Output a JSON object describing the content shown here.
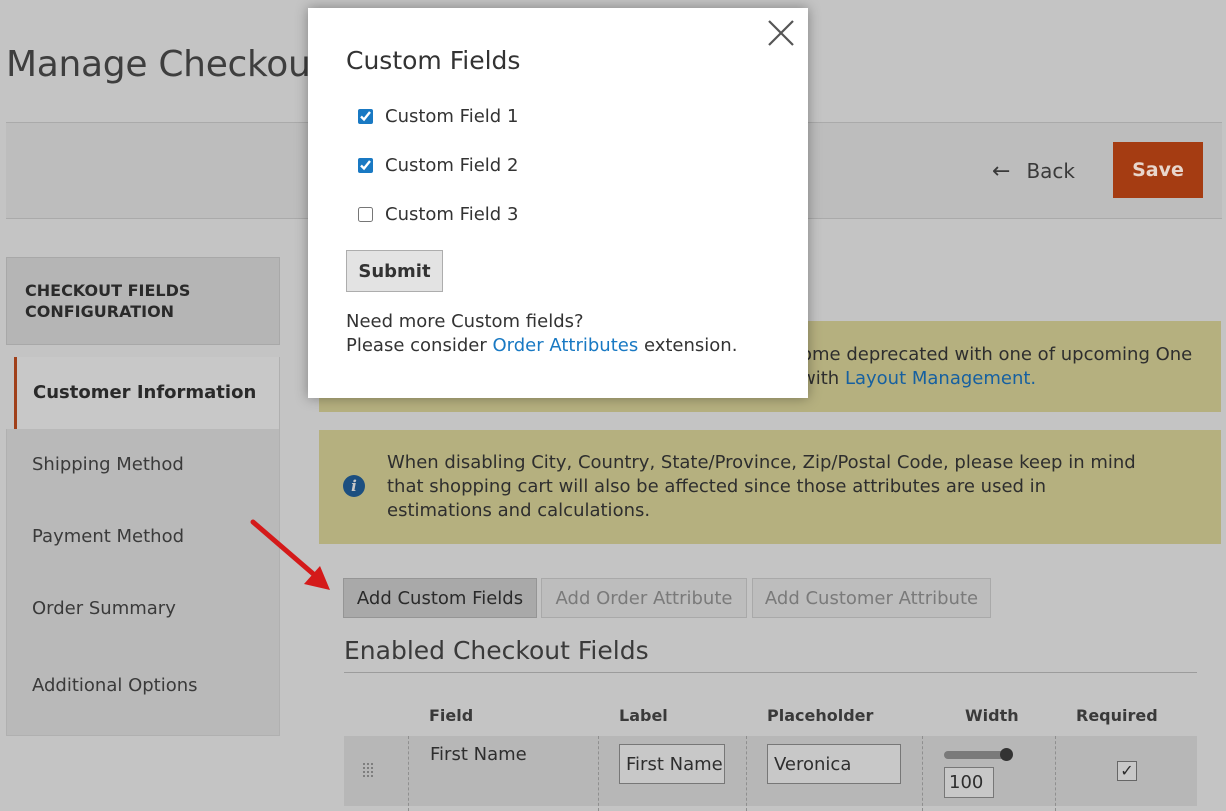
{
  "page": {
    "title": "Manage Checkout"
  },
  "toolbar": {
    "back_label": "Back",
    "back_arrow": "←",
    "save_label": "Save"
  },
  "sidebar": {
    "title": "CHECKOUT FIELDS CONFIGURATION",
    "items": [
      {
        "label": "Customer Information",
        "active": true
      },
      {
        "label": "Shipping Method"
      },
      {
        "label": "Payment Method"
      },
      {
        "label": "Order Summary"
      },
      {
        "label": "Additional Options"
      }
    ]
  },
  "notices": {
    "deprecated_text": "ome deprecated with one of upcoming One",
    "deprecated_text2": "with",
    "deprecated_link": "Layout Management.",
    "info_icon": "i",
    "info_text": "When disabling City, Country, State/Province, Zip/Postal Code, please keep in mind that shopping cart will also be affected since those attributes are used in estimations and calculations."
  },
  "buttons": {
    "add_custom_fields": "Add Custom Fields",
    "add_order_attribute": "Add Order Attribute",
    "add_customer_attribute": "Add Customer Attribute"
  },
  "section": {
    "title": "Enabled Checkout Fields"
  },
  "table": {
    "headers": {
      "field": "Field",
      "label": "Label",
      "placeholder": "Placeholder",
      "width": "Width",
      "required": "Required"
    },
    "rows": [
      {
        "field": "First Name",
        "label": "First Name",
        "placeholder": "Veronica",
        "width": "100",
        "required_mark": "✓"
      }
    ]
  },
  "modal": {
    "title": "Custom Fields",
    "fields": [
      {
        "label": "Custom Field 1",
        "checked": true
      },
      {
        "label": "Custom Field 2",
        "checked": true
      },
      {
        "label": "Custom Field 3",
        "checked": false
      }
    ],
    "submit_label": "Submit",
    "note_line1": "Need more Custom fields?",
    "note_prefix": "Please consider",
    "note_link": "Order Attributes",
    "note_suffix": "extension."
  },
  "colors": {
    "accent": "#a53c12",
    "link": "#1979c3",
    "notice_bg": "#b5b07f"
  }
}
